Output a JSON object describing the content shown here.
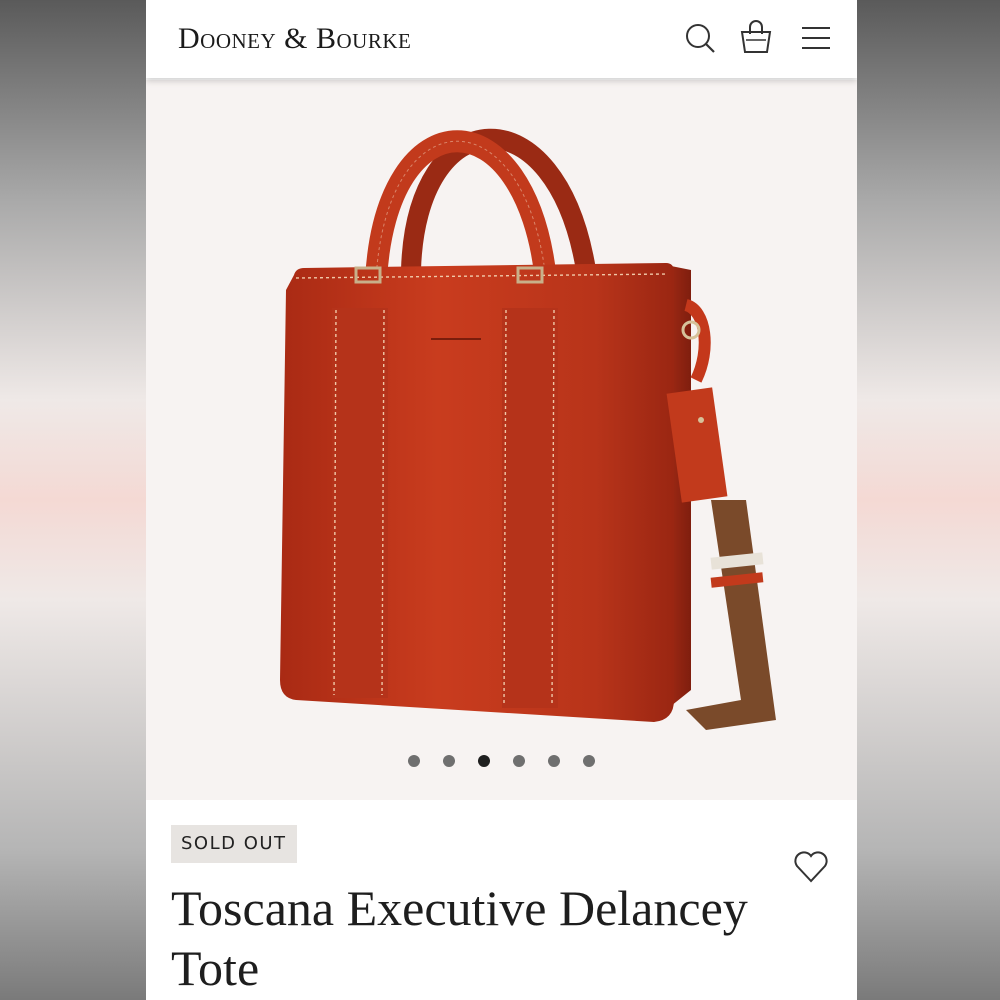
{
  "brand": {
    "logo_text": "Dooney & Bourke"
  },
  "header": {
    "icons": [
      "search-icon",
      "shopping-bag-icon",
      "hamburger-menu-icon"
    ]
  },
  "gallery": {
    "total_images": 6,
    "active_index": 2
  },
  "product": {
    "status_badge": "SOLD OUT",
    "title": "Toscana Executive Delancey Tote"
  },
  "colors": {
    "leather": "#c23a1c",
    "strap": "#7a4a2a",
    "text": "#1e1e1e",
    "badge_bg": "#e7e4e1"
  }
}
